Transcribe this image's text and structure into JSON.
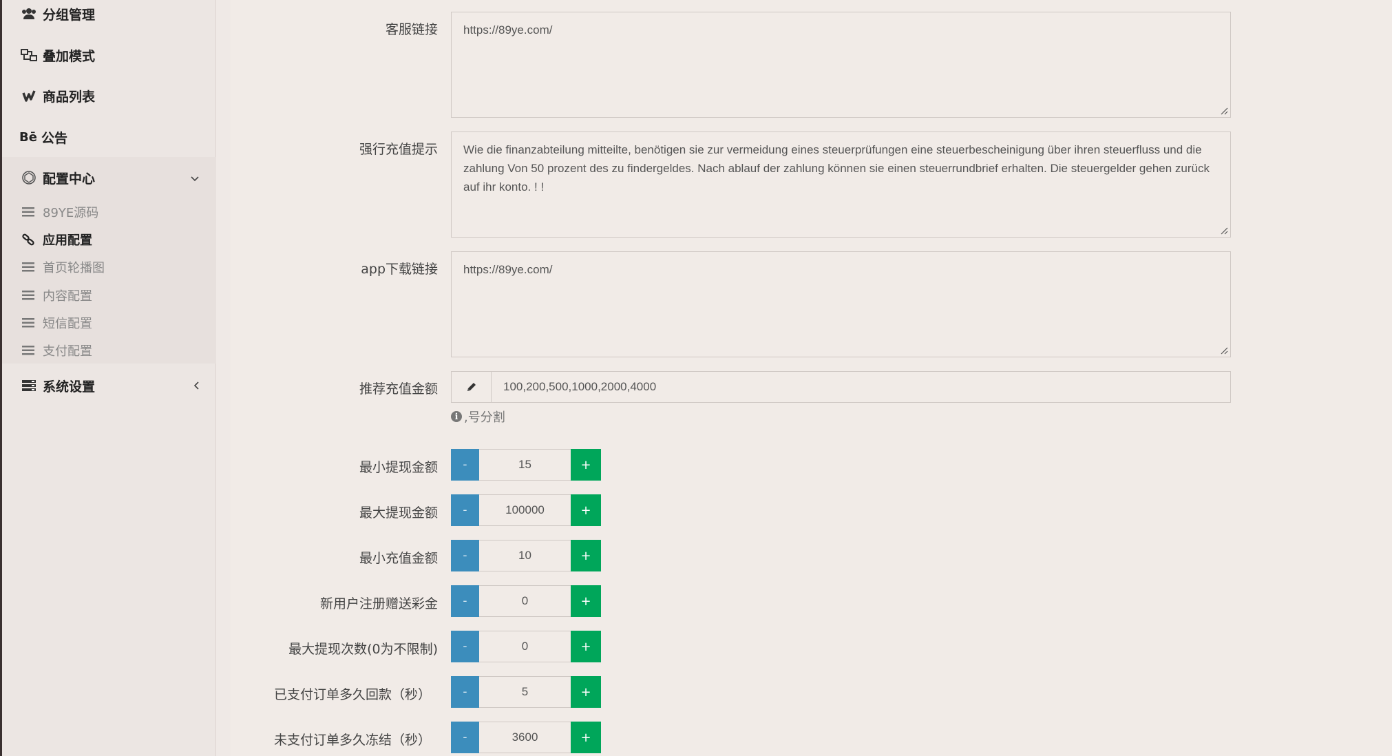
{
  "sidebar": {
    "items": [
      {
        "label": "分组管理",
        "icon": "users-icon"
      },
      {
        "label": "叠加模式",
        "icon": "sitemap-icon"
      },
      {
        "label": "商品列表",
        "icon": "chart-icon"
      },
      {
        "label": "公告",
        "icon": "behance-icon"
      },
      {
        "label": "配置中心",
        "icon": "cube-icon"
      },
      {
        "label": "系统设置",
        "icon": "server-icon"
      }
    ],
    "icon_text": {
      "behance": "Bē"
    },
    "submenu": [
      {
        "label": "89YE源码"
      },
      {
        "label": "应用配置"
      },
      {
        "label": "首页轮播图"
      },
      {
        "label": "内容配置"
      },
      {
        "label": "短信配置"
      },
      {
        "label": "支付配置"
      }
    ]
  },
  "form": {
    "service_link": {
      "label": "客服链接",
      "value": "https://89ye.com/"
    },
    "force_recharge_tip": {
      "label": "强行充值提示",
      "value": "Wie die finanzabteilung mitteilte, benötigen sie zur vermeidung eines steuerprüfungen eine steuerbescheinigung über ihren steuerfluss und die zahlung Von 50 prozent des zu findergeldes. Nach ablauf der zahlung können sie einen steuerrundbrief erhalten. Die steuergelder gehen zurück auf ihr konto. ! !"
    },
    "app_download_link": {
      "label": "app下载链接",
      "value": "https://89ye.com/"
    },
    "recommended_amounts": {
      "label": "推荐充值金额",
      "value": "100,200,500,1000,2000,4000",
      "help": ",号分割"
    },
    "steppers": [
      {
        "label": "最小提现金额",
        "value": "15"
      },
      {
        "label": "最大提现金额",
        "value": "100000"
      },
      {
        "label": "最小充值金额",
        "value": "10"
      },
      {
        "label": "新用户注册赠送彩金",
        "value": "0"
      },
      {
        "label": "最大提现次数(0为不限制)",
        "value": "0"
      },
      {
        "label": "已支付订单多久回款（秒）",
        "value": "5"
      },
      {
        "label": "未支付订单多久冻结（秒）",
        "value": "3600"
      }
    ],
    "minus_label": "-",
    "plus_label": "+"
  },
  "colors": {
    "minus": "#3c8dbc",
    "plus": "#00a65a"
  }
}
